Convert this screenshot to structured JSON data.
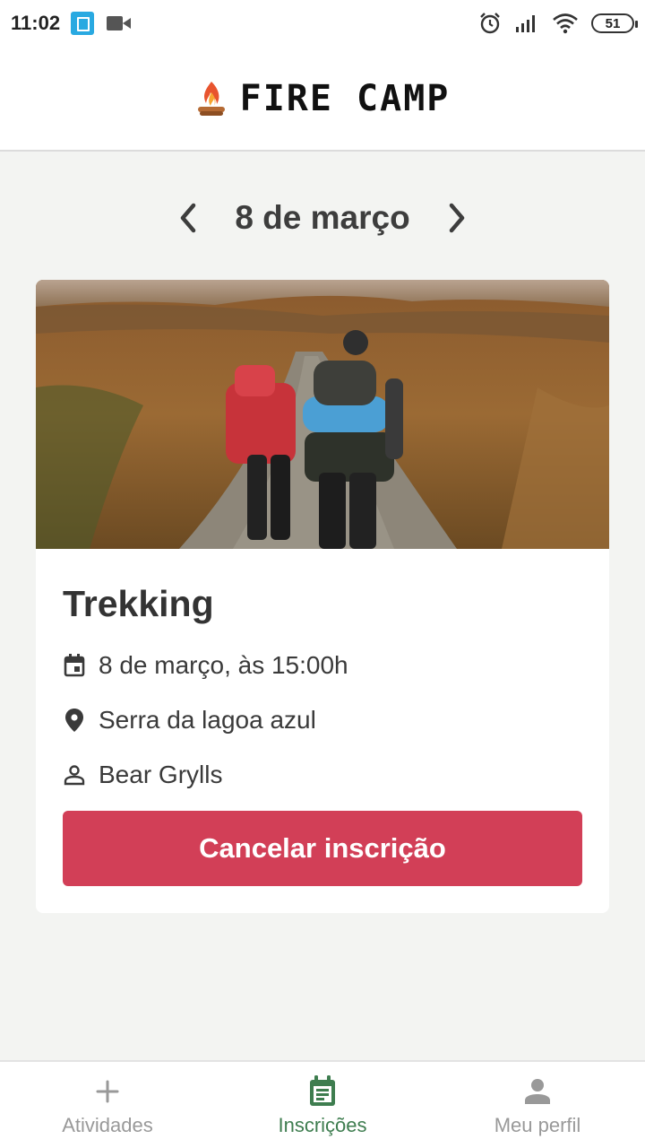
{
  "status_bar": {
    "time": "11:02",
    "battery": "51",
    "icons": [
      "sim-card-icon",
      "video-camera-icon",
      "alarm-icon",
      "signal-icon",
      "wifi-icon",
      "battery-icon"
    ]
  },
  "header": {
    "logo_text": "FIRE CAMP",
    "logo_icon": "campfire-icon"
  },
  "date_nav": {
    "date": "8 de março",
    "prev_icon": "chevron-left-icon",
    "next_icon": "chevron-right-icon"
  },
  "activity": {
    "image": "hikers-trekking-photo",
    "title": "Trekking",
    "datetime": "8 de março, às 15:00h",
    "location": "Serra da lagoa azul",
    "guide": "Bear Grylls",
    "cancel_label": "Cancelar inscrição"
  },
  "bottom_nav": {
    "items": [
      {
        "label": "Atividades",
        "icon": "plus-icon",
        "active": false
      },
      {
        "label": "Inscrições",
        "icon": "calendar-list-icon",
        "active": true
      },
      {
        "label": "Meu perfil",
        "icon": "person-icon",
        "active": false
      }
    ]
  },
  "colors": {
    "accent_red": "#d23f57",
    "active_green": "#3e7d4f",
    "background": "#f3f4f2"
  }
}
